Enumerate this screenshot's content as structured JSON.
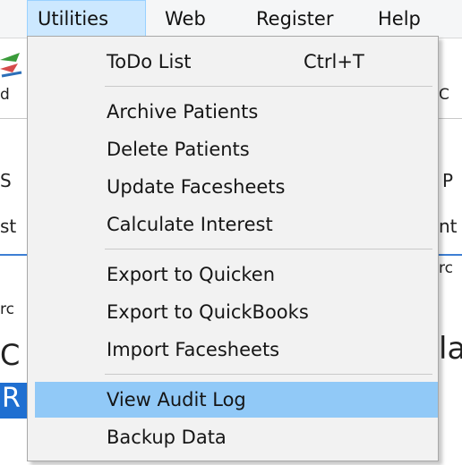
{
  "menubar": {
    "items": [
      {
        "label": "Utilities",
        "active": true
      },
      {
        "label": "Web"
      },
      {
        "label": "Register"
      },
      {
        "label": "Help"
      }
    ]
  },
  "background": {
    "fragments": [
      "d",
      "S",
      "st",
      "rc",
      "C",
      "R",
      "C",
      "P",
      "nt",
      "rc",
      "la"
    ]
  },
  "utilities_menu": {
    "todo": {
      "label": "ToDo List",
      "shortcut": "Ctrl+T"
    },
    "archive": {
      "label": "Archive Patients"
    },
    "delete": {
      "label": "Delete Patients"
    },
    "update": {
      "label": "Update Facesheets"
    },
    "interest": {
      "label": "Calculate Interest"
    },
    "quicken": {
      "label": "Export to Quicken"
    },
    "quickbooks": {
      "label": "Export to QuickBooks"
    },
    "import": {
      "label": "Import Facesheets"
    },
    "audit": {
      "label": "View Audit Log",
      "highlighted": true
    },
    "backup": {
      "label": "Backup Data"
    }
  },
  "colors": {
    "highlight": "#91c9f7",
    "menu_active": "#cce8ff",
    "accent_blue": "#1f6fd1"
  }
}
